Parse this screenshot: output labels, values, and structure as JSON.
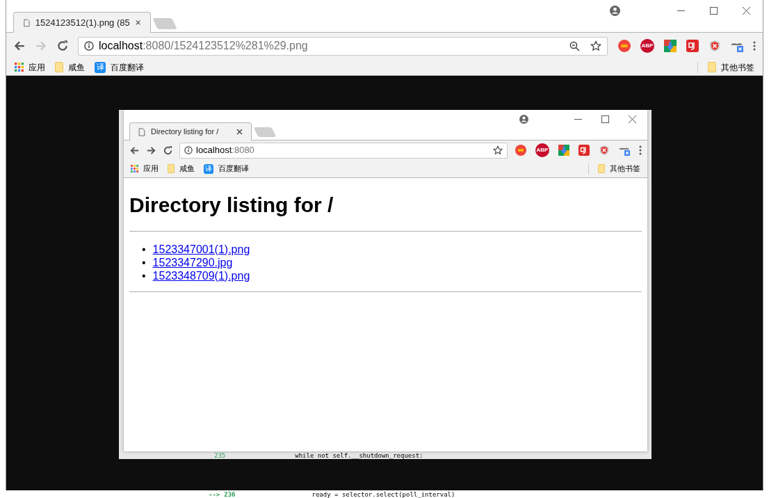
{
  "outer_browser": {
    "tab": {
      "title": "1524123512(1).png (85"
    },
    "nav": {
      "forward_disabled": true
    },
    "address": {
      "host": "localhost",
      "rest": ":8080/1524123512%281%29.png"
    },
    "zoom_icon": true,
    "extensions": [
      {
        "kind": "infinity"
      },
      {
        "kind": "abp",
        "label": "ABP"
      },
      {
        "kind": "download"
      },
      {
        "kind": "redapp"
      },
      {
        "kind": "shield"
      },
      {
        "kind": "glasses"
      }
    ],
    "bookmarks": [
      {
        "kind": "apps",
        "label": "应用"
      },
      {
        "kind": "folder",
        "label": "咸鱼"
      },
      {
        "kind": "translate",
        "label": "百度翻译",
        "badge": "译"
      }
    ],
    "other_bookmarks": "其他书签"
  },
  "image": {
    "browser": {
      "tab": {
        "title": "Directory listing for /"
      },
      "nav": {
        "forward_disabled": false
      },
      "address": {
        "host": "localhost",
        "rest": ":8080"
      },
      "zoom_icon": false,
      "extensions": [
        {
          "kind": "infinity"
        },
        {
          "kind": "abp",
          "label": "ABP"
        },
        {
          "kind": "download"
        },
        {
          "kind": "redapp"
        },
        {
          "kind": "shield"
        },
        {
          "kind": "glasses"
        }
      ],
      "bookmarks": [
        {
          "kind": "apps",
          "label": "应用"
        },
        {
          "kind": "folder",
          "label": "咸鱼"
        },
        {
          "kind": "translate",
          "label": "百度翻译",
          "badge": "译"
        }
      ],
      "other_bookmarks": "其他书签"
    },
    "page": {
      "heading": "Directory listing for /",
      "files": [
        {
          "marker": "•",
          "name": "1523347001(1).png"
        },
        {
          "marker": "•",
          "name": "1523347290.jpg"
        },
        {
          "marker": "•",
          "name": "1523348709(1).png"
        }
      ]
    },
    "code_line": {
      "number": "235",
      "code": "while not self.__shutdown_request:"
    }
  },
  "background_code": {
    "marker": "-->",
    "number": "236",
    "code": "ready = selector.select(poll_interval)"
  }
}
